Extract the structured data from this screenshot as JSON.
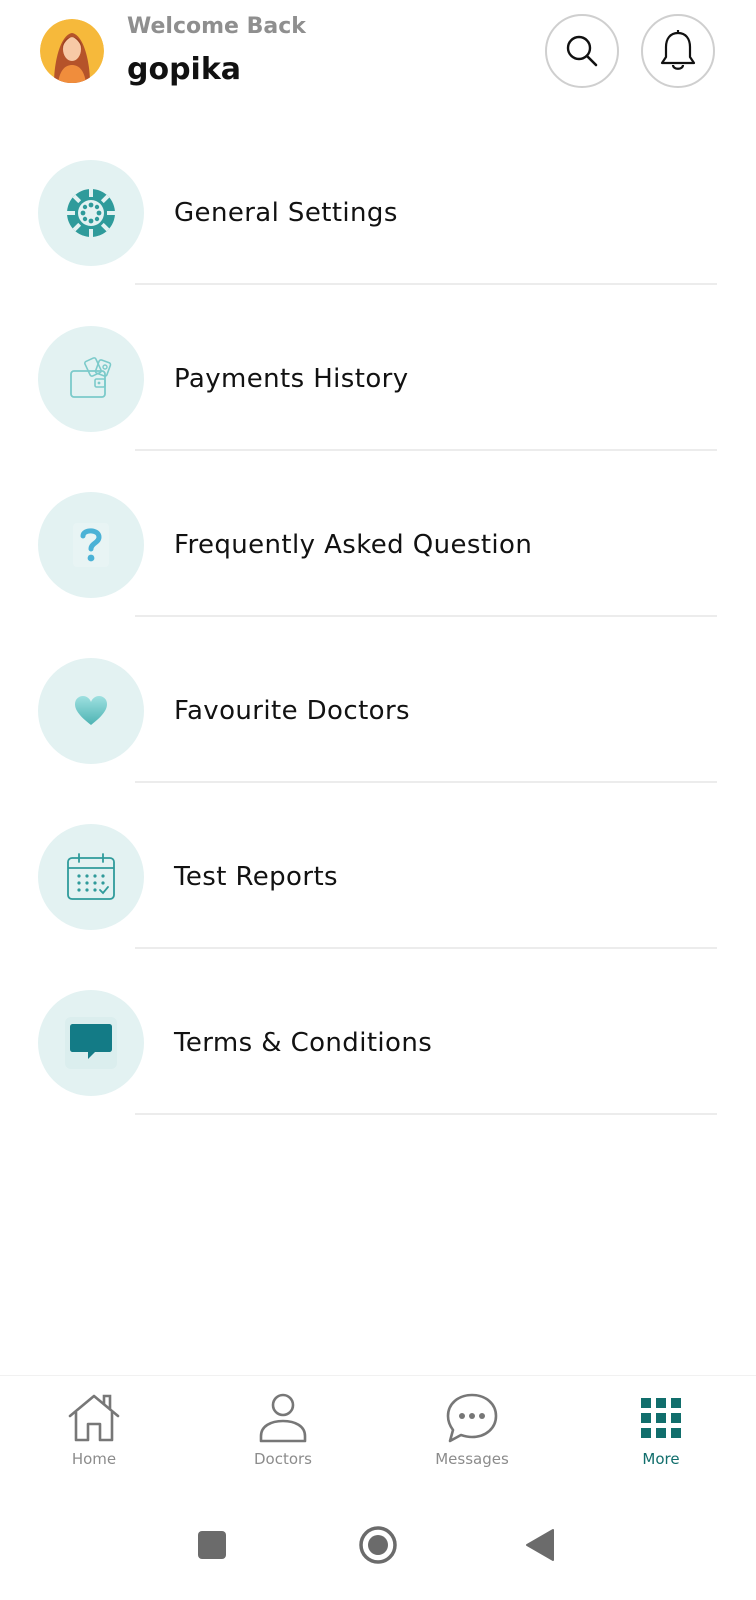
{
  "header": {
    "welcome_text": "Welcome Back",
    "username": "gopika",
    "search_icon": "search-icon",
    "notification_icon": "bell-icon"
  },
  "menu": {
    "items": [
      {
        "label": "General Settings",
        "icon": "settings-icon"
      },
      {
        "label": "Payments History",
        "icon": "wallet-icon"
      },
      {
        "label": "Frequently Asked Question",
        "icon": "question-icon"
      },
      {
        "label": "Favourite Doctors",
        "icon": "heart-icon"
      },
      {
        "label": "Test Reports",
        "icon": "calendar-icon"
      },
      {
        "label": "Terms & Conditions",
        "icon": "chat-bubble-icon"
      }
    ]
  },
  "bottom_nav": {
    "items": [
      {
        "label": "Home",
        "icon": "home-icon",
        "active": false
      },
      {
        "label": "Doctors",
        "icon": "user-icon",
        "active": false
      },
      {
        "label": "Messages",
        "icon": "message-icon",
        "active": false
      },
      {
        "label": "More",
        "icon": "grid-icon",
        "active": true
      }
    ]
  },
  "system_bar": {
    "buttons": [
      "recent-apps-icon",
      "home-circle-icon",
      "back-icon"
    ]
  },
  "colors": {
    "accent": "#116e6c",
    "icon_bg": "#e3f2f2",
    "teal": "#3aa6a6"
  }
}
